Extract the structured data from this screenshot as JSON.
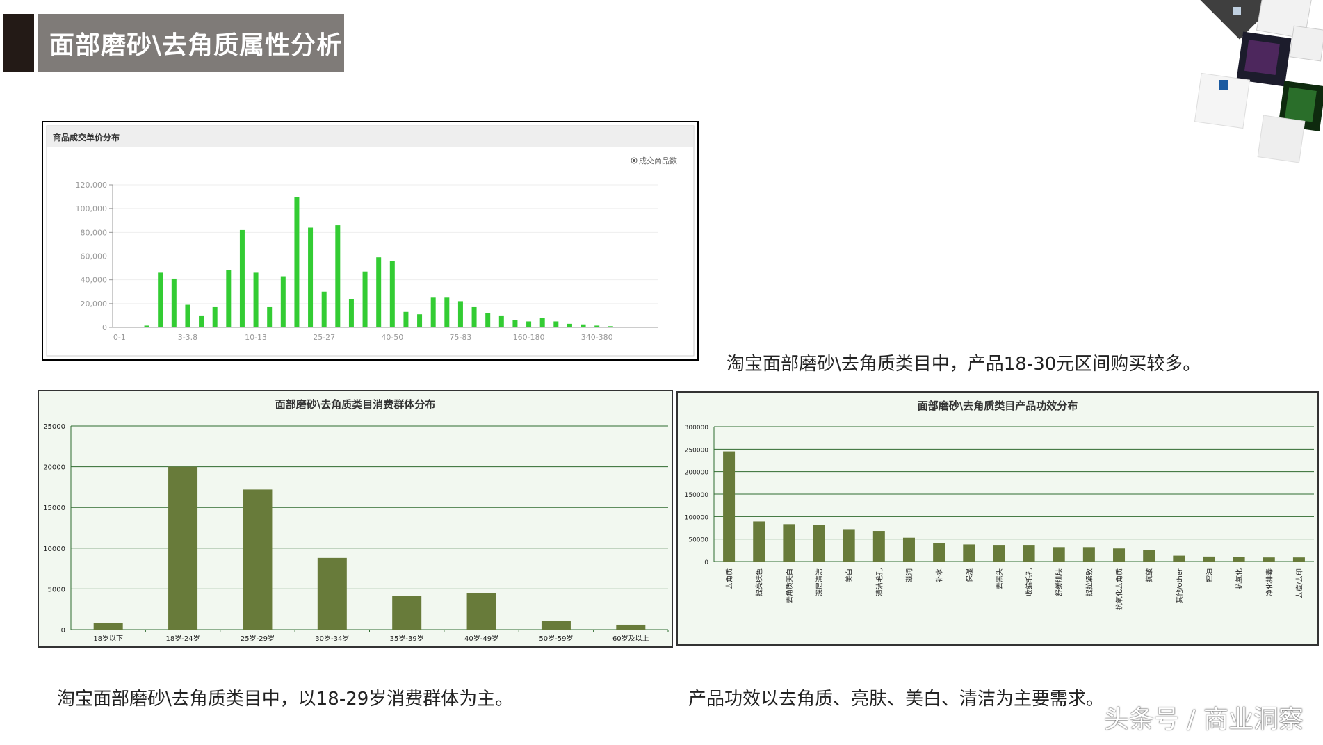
{
  "page": {
    "title": "面部磨砂\\去角质属性分析",
    "caption_price": "淘宝面部磨砂\\去角质类目中，产品18-30元区间购买较多。",
    "caption_age": "淘宝面部磨砂\\去角质类目中，以18-29岁消费群体为主。",
    "caption_effect": "产品功效以去角质、亮肤、美白、清洁为主要需求。",
    "watermark": "头条号 / 商业洞察"
  },
  "chart_data": [
    {
      "type": "bar",
      "title": "商品成交单价分布",
      "legend": "成交商品数",
      "legend_position": "top-right",
      "color": "#33cc33",
      "ylim": [
        0,
        120000
      ],
      "yticks": [
        "0",
        "20,000",
        "40,000",
        "60,000",
        "80,000",
        "100,000",
        "120,000"
      ],
      "xtick_labels": [
        "0-1",
        "3-3.8",
        "10-13",
        "25-27",
        "40-50",
        "75-83",
        "160-180",
        "340-380"
      ],
      "grid": true,
      "values": [
        300,
        300,
        1500,
        46000,
        41000,
        19000,
        10000,
        17000,
        48000,
        82000,
        46000,
        17000,
        43000,
        110000,
        84000,
        30000,
        86000,
        24000,
        47000,
        59000,
        56000,
        13000,
        11000,
        25000,
        25000,
        22000,
        17000,
        12000,
        10000,
        6000,
        5000,
        8000,
        5000,
        3000,
        2500,
        1500,
        1000,
        500,
        300,
        300
      ]
    },
    {
      "type": "bar",
      "title": "面部磨砂\\去角质类目消费群体分布",
      "color": "#687b3a",
      "ylim": [
        0,
        25000
      ],
      "yticks": [
        "0",
        "5000",
        "10000",
        "15000",
        "20000",
        "25000"
      ],
      "grid": true,
      "categories": [
        "18岁以下",
        "18岁-24岁",
        "25岁-29岁",
        "30岁-34岁",
        "35岁-39岁",
        "40岁-49岁",
        "50岁-59岁",
        "60岁及以上"
      ],
      "values": [
        800,
        20000,
        17200,
        8800,
        4100,
        4500,
        1100,
        600
      ]
    },
    {
      "type": "bar",
      "title": "面部磨砂\\去角质类目产品功效分布",
      "color": "#687b3a",
      "ylim": [
        0,
        300000
      ],
      "yticks": [
        "0",
        "50000",
        "100000",
        "150000",
        "200000",
        "250000",
        "300000"
      ],
      "grid": true,
      "categories": [
        "去角质",
        "提亮肤色",
        "去角质美白",
        "深层清洁",
        "美白",
        "清洁毛孔",
        "滋润",
        "补水",
        "保湿",
        "去黑头",
        "收缩毛孔",
        "舒缓肌肤",
        "提拉紧致",
        "抗氧化去角质",
        "抗皱",
        "其他/other",
        "控油",
        "抗氧化",
        "净化排毒",
        "去痘/去印"
      ],
      "values": [
        245000,
        89000,
        83000,
        81000,
        72000,
        68000,
        53000,
        41000,
        38000,
        37000,
        37000,
        32000,
        32000,
        29000,
        26000,
        13000,
        11000,
        10000,
        9000,
        9000
      ]
    }
  ]
}
